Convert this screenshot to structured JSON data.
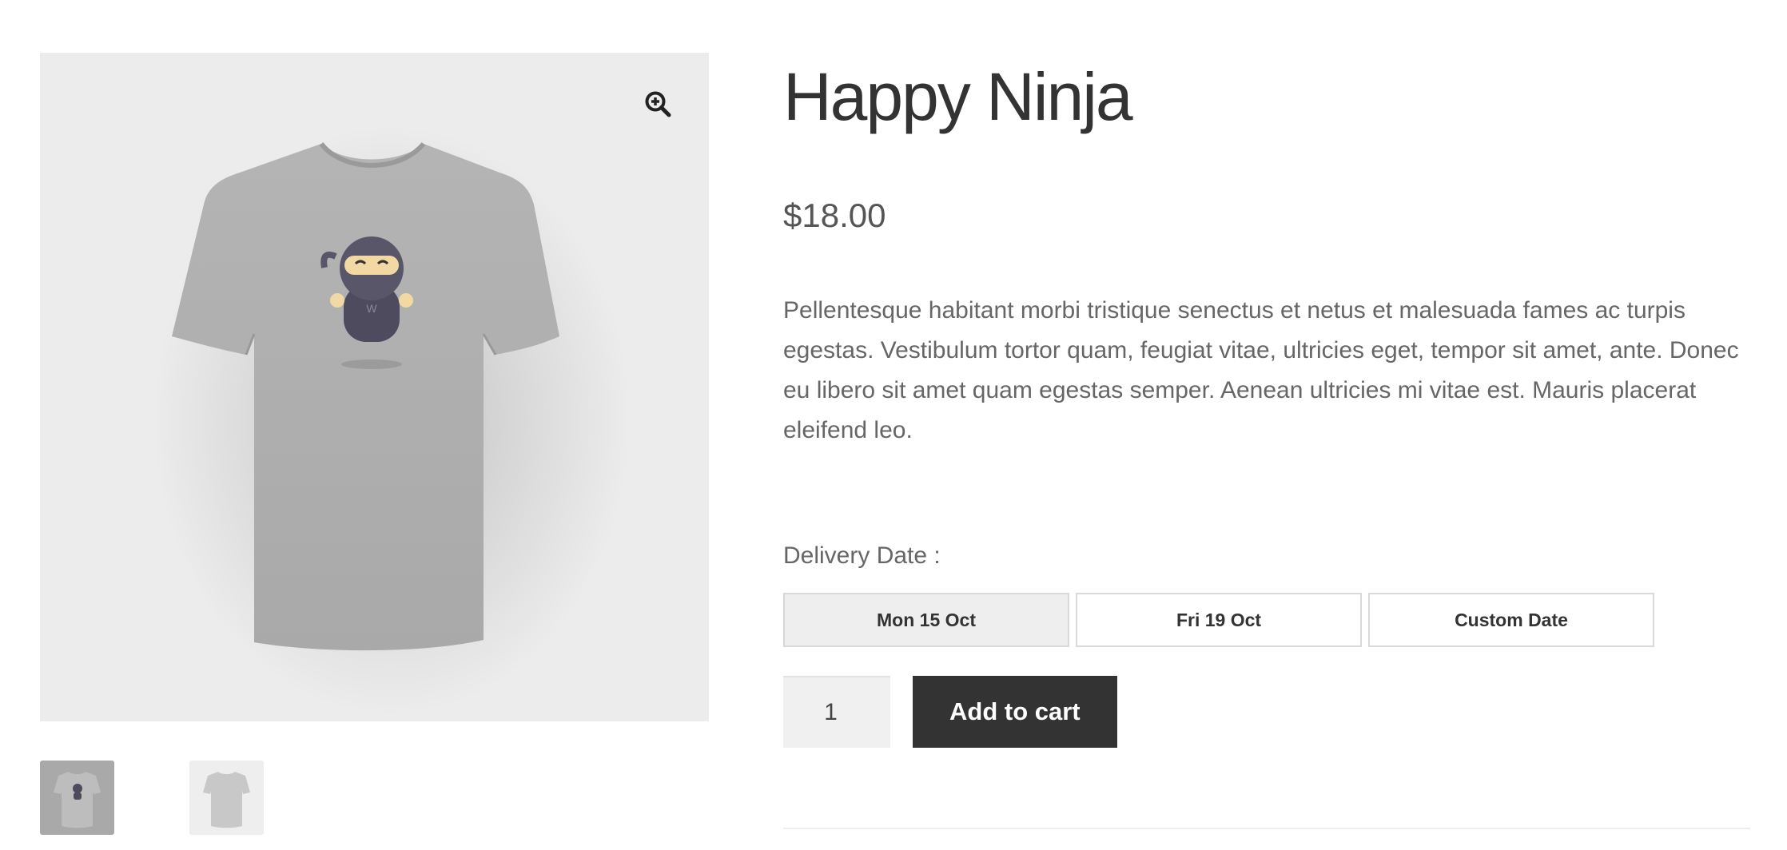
{
  "product": {
    "title": "Happy Ninja",
    "price": "$18.00",
    "description": "Pellentesque habitant morbi tristique senectus et netus et malesuada fames ac turpis egestas. Vestibulum tortor quam, feugiat vitae, ultricies eget, tempor sit amet, ante. Donec eu libero sit amet quam egestas semper. Aenean ultricies mi vitae est. Mauris placerat eleifend leo."
  },
  "gallery": {
    "zoom_icon": "zoom-in-icon",
    "main_image": "tshirt-happy-ninja",
    "thumbnails": [
      "tshirt-front-ninja",
      "tshirt-back-plain"
    ]
  },
  "delivery": {
    "label": "Delivery Date :",
    "options": [
      {
        "label": "Mon 15 Oct",
        "selected": true
      },
      {
        "label": "Fri 19 Oct",
        "selected": false
      },
      {
        "label": "Custom Date",
        "selected": false
      }
    ]
  },
  "cart": {
    "quantity": "1",
    "button_label": "Add to cart"
  },
  "colors": {
    "accent_button": "#333333",
    "image_background": "#ececec"
  }
}
